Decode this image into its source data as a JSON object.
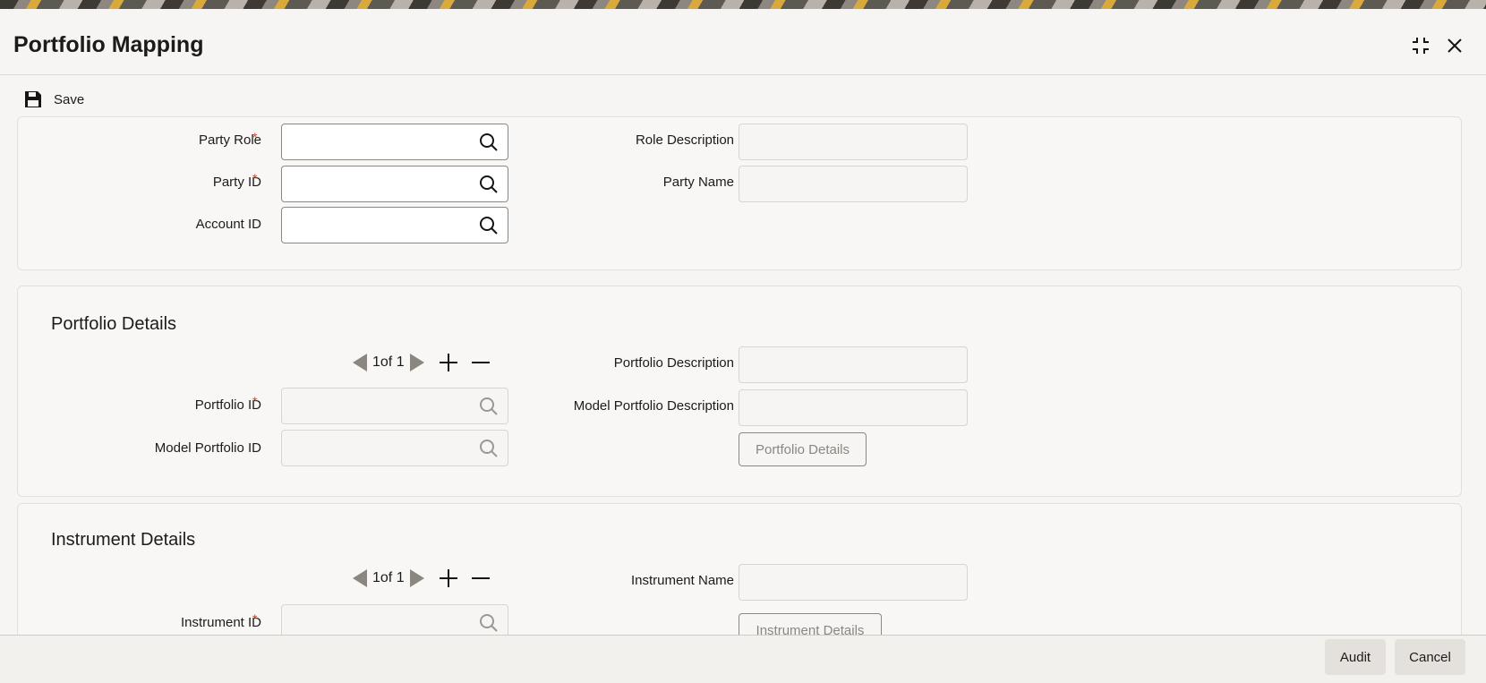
{
  "window": {
    "title": "Portfolio Mapping",
    "expand_icon": "expand-icon",
    "close_icon": "close-icon"
  },
  "toolbar": {
    "save_label": "Save",
    "save_icon": "floppy-disk-icon"
  },
  "main": {
    "party_role": {
      "label": "Party Role",
      "required": "*",
      "value": ""
    },
    "party_id": {
      "label": "Party ID",
      "required": "*",
      "value": ""
    },
    "account_id": {
      "label": "Account ID",
      "value": ""
    },
    "role_description": {
      "label": "Role Description",
      "value": ""
    },
    "party_name": {
      "label": "Party Name",
      "value": ""
    }
  },
  "portfolio": {
    "title": "Portfolio Details",
    "pager": "1of 1",
    "portfolio_id": {
      "label": "Portfolio ID",
      "required": "*",
      "value": ""
    },
    "model_portfolio_id": {
      "label": "Model Portfolio ID",
      "value": ""
    },
    "portfolio_description": {
      "label": "Portfolio Description",
      "value": ""
    },
    "model_portfolio_description": {
      "label": "Model Portfolio Description",
      "value": ""
    },
    "button": "Portfolio Details"
  },
  "instrument": {
    "title": "Instrument Details",
    "pager": "1of 1",
    "instrument_id": {
      "label": "Instrument ID",
      "required": "*",
      "value": ""
    },
    "instrument_name": {
      "label": "Instrument Name",
      "value": ""
    },
    "button": "Instrument Details"
  },
  "footer": {
    "audit": "Audit",
    "cancel": "Cancel"
  },
  "colors": {
    "required": "#c74634",
    "panel_bg": "#f8f7f5",
    "button_bg": "#e4e1dd"
  }
}
